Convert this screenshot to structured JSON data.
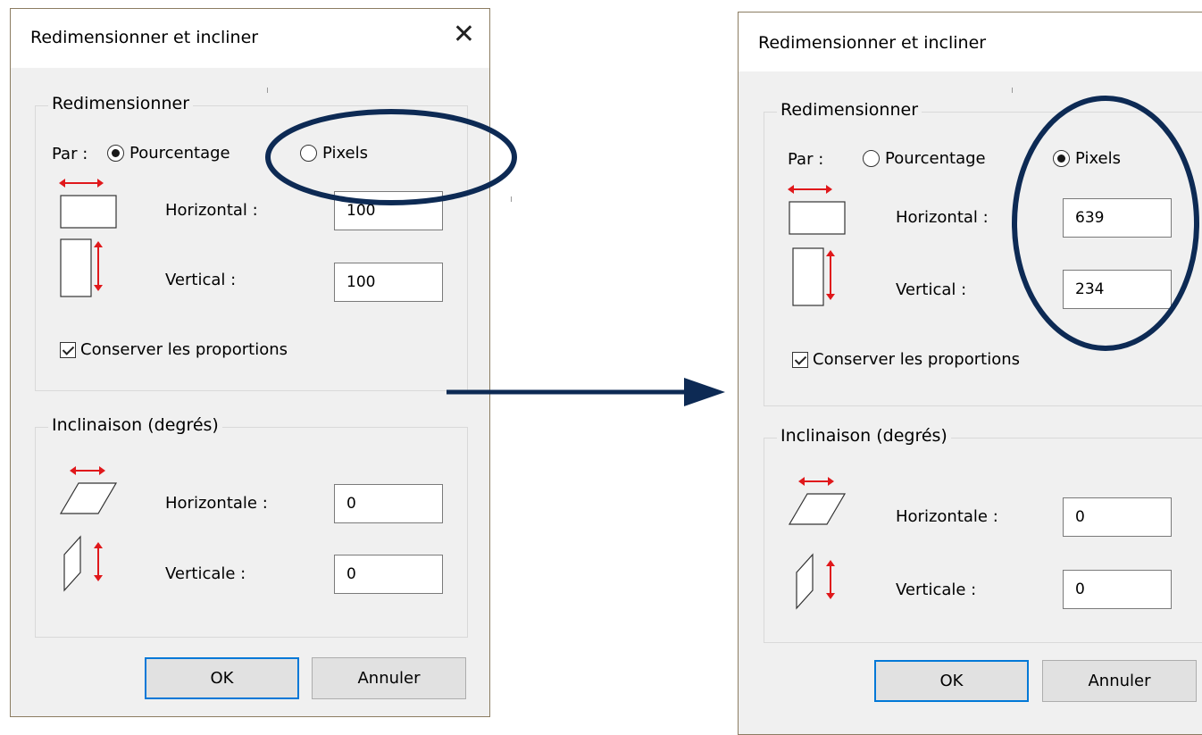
{
  "dialogs": {
    "left": {
      "title": "Redimensionner et incliner",
      "resize_group": "Redimensionner",
      "by_label": "Par :",
      "option_percent": "Pourcentage",
      "option_pixels": "Pixels",
      "selected": "Pourcentage",
      "horizontal_label": "Horizontal :",
      "horizontal_value": "100",
      "vertical_label": "Vertical :",
      "vertical_value": "100",
      "keep_ratio": "Conserver les proportions",
      "keep_ratio_checked": true,
      "skew_group": "Inclinaison (degrés)",
      "skew_h_label": "Horizontale :",
      "skew_h_value": "0",
      "skew_v_label": "Verticale :",
      "skew_v_value": "0",
      "ok": "OK",
      "cancel": "Annuler"
    },
    "right": {
      "title": "Redimensionner et incliner",
      "resize_group": "Redimensionner",
      "by_label": "Par :",
      "option_percent": "Pourcentage",
      "option_pixels": "Pixels",
      "selected": "Pixels",
      "horizontal_label": "Horizontal :",
      "horizontal_value": "639",
      "vertical_label": "Vertical :",
      "vertical_value": "234",
      "keep_ratio": "Conserver les proportions",
      "keep_ratio_checked": true,
      "skew_group": "Inclinaison (degrés)",
      "skew_h_label": "Horizontale :",
      "skew_h_value": "0",
      "skew_v_label": "Verticale :",
      "skew_v_value": "0",
      "ok": "OK",
      "cancel": "Annuler"
    }
  },
  "annotations": {
    "highlight_color": "#0d2a54",
    "arrow_color": "#0d2a54",
    "arrow_direction": "left-to-right"
  },
  "colors": {
    "dialog_face": "#f0f0f0",
    "icon_arrow": "#e0181b",
    "default_button_border": "#0078d7"
  }
}
